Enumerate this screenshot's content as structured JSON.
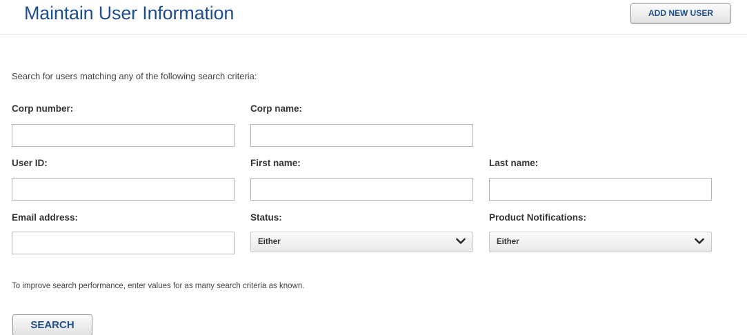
{
  "header": {
    "title": "Maintain User Information",
    "add_user_label": "ADD NEW USER"
  },
  "intro_text": "Search for users matching any of the following search criteria:",
  "fields": {
    "corp_number": {
      "label": "Corp number:",
      "value": ""
    },
    "corp_name": {
      "label": "Corp name:",
      "value": ""
    },
    "user_id": {
      "label": "User ID:",
      "value": ""
    },
    "first_name": {
      "label": "First name:",
      "value": ""
    },
    "last_name": {
      "label": "Last name:",
      "value": ""
    },
    "email": {
      "label": "Email address:",
      "value": ""
    },
    "status": {
      "label": "Status:",
      "selected": "Either"
    },
    "product_notifications": {
      "label": "Product Notifications:",
      "selected": "Either"
    }
  },
  "hint_text": "To improve search performance, enter values for as many search criteria as known.",
  "search_label": "SEARCH",
  "colors": {
    "title": "#1f4e8c",
    "button_text": "#1f4e8c",
    "chevron": "#2a2a2a"
  },
  "icons": {
    "dropdown": "chevron-down-icon"
  }
}
